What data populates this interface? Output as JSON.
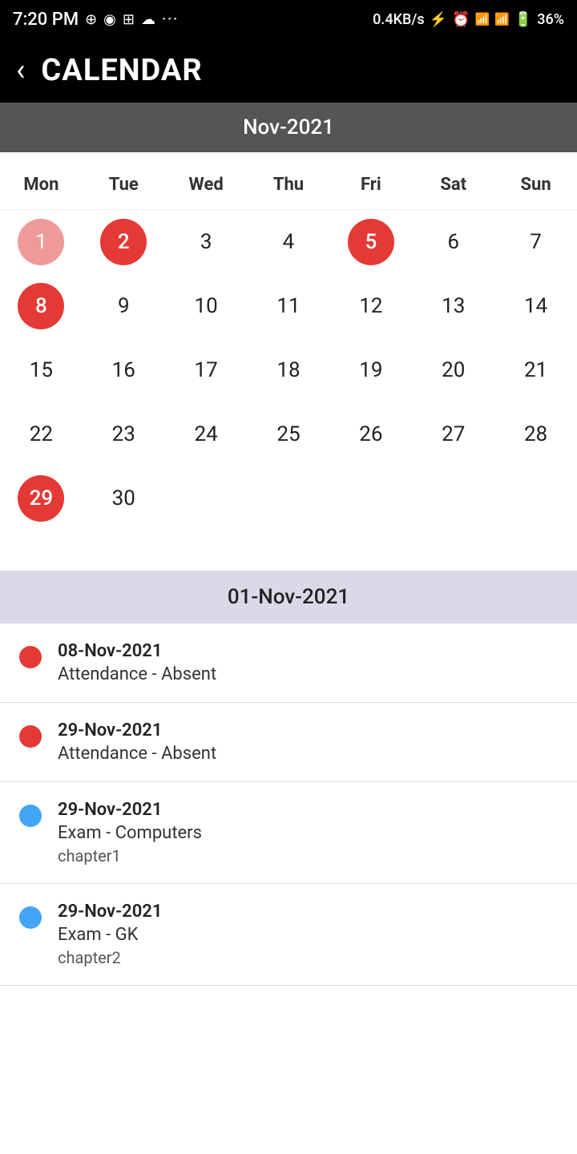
{
  "statusBar": {
    "time": "7:20 PM",
    "network": "0.4KB/s",
    "battery": "36%"
  },
  "header": {
    "title": "CALENDAR",
    "backLabel": "‹"
  },
  "calendar": {
    "monthLabel": "Nov-2021",
    "weekdays": [
      "Mon",
      "Tue",
      "Wed",
      "Thu",
      "Fri",
      "Sat",
      "Sun"
    ],
    "days": [
      {
        "day": "1",
        "style": "red-light"
      },
      {
        "day": "2",
        "style": "red-circle"
      },
      {
        "day": "3",
        "style": "normal"
      },
      {
        "day": "4",
        "style": "normal"
      },
      {
        "day": "5",
        "style": "red-circle"
      },
      {
        "day": "6",
        "style": "normal"
      },
      {
        "day": "7",
        "style": "normal"
      },
      {
        "day": "8",
        "style": "red-circle"
      },
      {
        "day": "9",
        "style": "normal"
      },
      {
        "day": "10",
        "style": "normal"
      },
      {
        "day": "11",
        "style": "normal"
      },
      {
        "day": "12",
        "style": "normal"
      },
      {
        "day": "13",
        "style": "normal"
      },
      {
        "day": "14",
        "style": "normal"
      },
      {
        "day": "15",
        "style": "normal"
      },
      {
        "day": "16",
        "style": "normal"
      },
      {
        "day": "17",
        "style": "normal"
      },
      {
        "day": "18",
        "style": "normal"
      },
      {
        "day": "19",
        "style": "normal"
      },
      {
        "day": "20",
        "style": "normal"
      },
      {
        "day": "21",
        "style": "normal"
      },
      {
        "day": "22",
        "style": "normal"
      },
      {
        "day": "23",
        "style": "normal"
      },
      {
        "day": "24",
        "style": "normal"
      },
      {
        "day": "25",
        "style": "normal"
      },
      {
        "day": "26",
        "style": "normal"
      },
      {
        "day": "27",
        "style": "normal"
      },
      {
        "day": "28",
        "style": "normal"
      },
      {
        "day": "29",
        "style": "red-circle"
      },
      {
        "day": "30",
        "style": "normal"
      }
    ]
  },
  "eventSection": {
    "headerDate": "01-Nov-2021",
    "events": [
      {
        "dotColor": "dot-red",
        "date": "08-Nov-2021",
        "title": "Attendance - Absent",
        "subtitle": ""
      },
      {
        "dotColor": "dot-red",
        "date": "29-Nov-2021",
        "title": "Attendance - Absent",
        "subtitle": ""
      },
      {
        "dotColor": "dot-blue",
        "date": "29-Nov-2021",
        "title": "Exam - Computers",
        "subtitle": "chapter1"
      },
      {
        "dotColor": "dot-blue",
        "date": "29-Nov-2021",
        "title": "Exam - GK",
        "subtitle": "chapter2"
      }
    ]
  }
}
